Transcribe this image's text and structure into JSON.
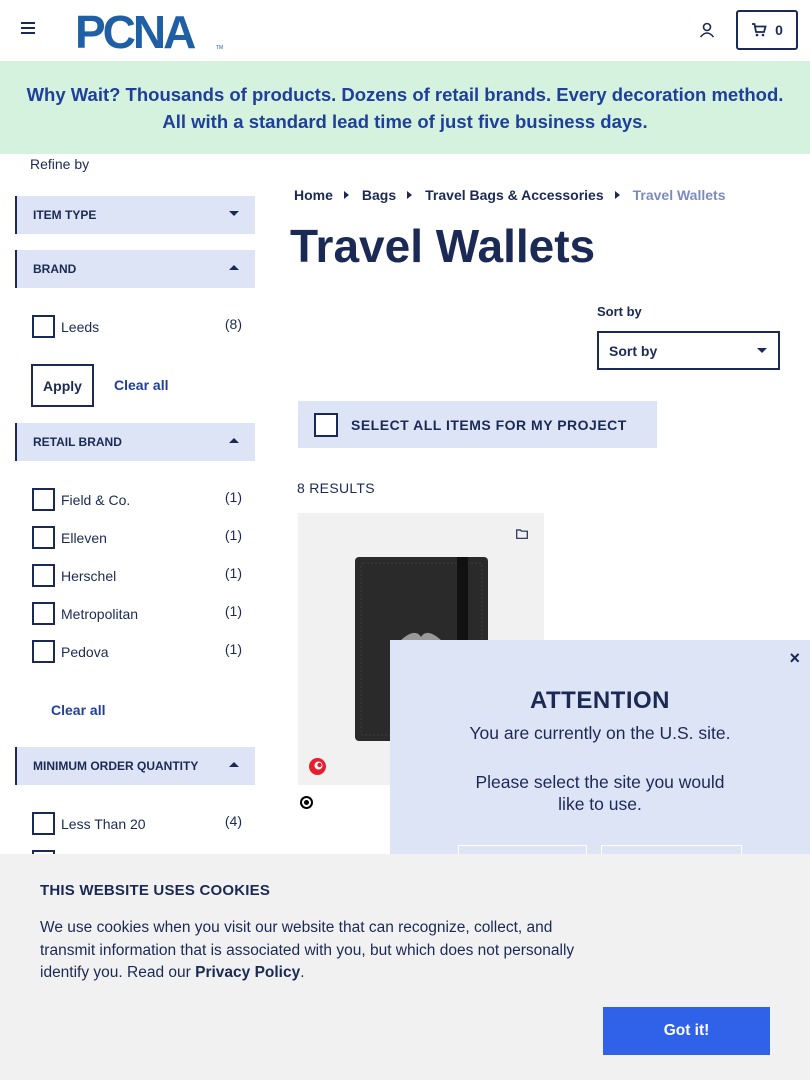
{
  "header": {
    "logo_text": "PCNA",
    "cart_count": "0"
  },
  "banner": {
    "text": "Why Wait? Thousands of products. Dozens of retail brands. Every decoration method. All with a standard lead time of just five business days."
  },
  "sidebar": {
    "refine_label": "Refine by",
    "facets": {
      "item_type": {
        "label": "ITEM TYPE"
      },
      "brand": {
        "label": "BRAND",
        "options": [
          {
            "label": "Leeds",
            "count": "(8)"
          }
        ],
        "apply_label": "Apply",
        "clear_label": "Clear all"
      },
      "retail_brand": {
        "label": "RETAIL BRAND",
        "options": [
          {
            "label": "Field & Co.",
            "count": "(1)"
          },
          {
            "label": "Elleven",
            "count": "(1)"
          },
          {
            "label": "Herschel",
            "count": "(1)"
          },
          {
            "label": "Metropolitan",
            "count": "(1)"
          },
          {
            "label": "Pedova",
            "count": "(1)"
          }
        ],
        "clear_label": "Clear all"
      },
      "min_order": {
        "label": "MINIMUM ORDER QUANTITY",
        "options": [
          {
            "label": "Less Than 20",
            "count": "(4)"
          }
        ]
      }
    }
  },
  "breadcrumb": [
    "Home",
    "Bags",
    "Travel Bags & Accessories",
    "Travel Wallets"
  ],
  "page_title": "Travel Wallets",
  "sort": {
    "label": "Sort by",
    "value": "Sort by"
  },
  "select_all_label": "SELECT ALL ITEMS FOR MY PROJECT",
  "results_count": "8 RESULTS",
  "colors": {
    "navy": "#1b2a55",
    "banner_bg": "#d4f2de",
    "facet_bg": "#dde4f6",
    "button_blue": "#2f62e8"
  },
  "modal": {
    "close": "×",
    "title": "ATTENTION",
    "line1": "You are currently on the U.S. site.",
    "line2": "Please select the site you would like to use."
  },
  "cookie": {
    "title": "THIS WEBSITE USES COOKIES",
    "text": "We use cookies when you visit our website that can recognize, collect, and transmit information that is associated with you, but which does not personally identify you. Read our",
    "link": "Privacy Policy",
    "period": ".",
    "button": "Got it!"
  }
}
